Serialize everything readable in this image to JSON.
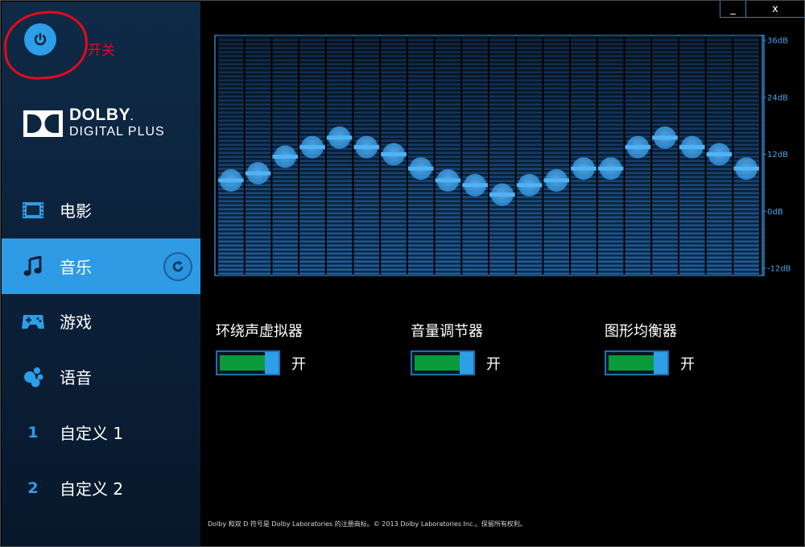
{
  "power": {
    "annotation": "开关",
    "icon": "power-icon"
  },
  "logo": {
    "name": "DOLBY",
    "sub": "DIGITAL PLUS",
    "trademark": "."
  },
  "nav": [
    {
      "label": "电影",
      "icon": "film-icon"
    },
    {
      "label": "音乐",
      "icon": "music-note-icon",
      "active": true,
      "reset_icon": "reset-icon"
    },
    {
      "label": "游戏",
      "icon": "gamepad-icon"
    },
    {
      "label": "语音",
      "icon": "voice-icon"
    },
    {
      "label": "自定义 1",
      "badge": "1"
    },
    {
      "label": "自定义 2",
      "badge": "2"
    }
  ],
  "window": {
    "minimize": "_",
    "close": "x"
  },
  "equalizer": {
    "db_labels": [
      "36dB",
      "24dB",
      "12dB",
      "0dB",
      "-12dB"
    ],
    "db_values": [
      36,
      24,
      12,
      0,
      -12
    ],
    "range": [
      -12,
      36
    ],
    "bands": [
      6.5,
      8,
      11.5,
      13.5,
      15.5,
      13.5,
      12,
      9,
      6.5,
      5.5,
      3.5,
      5.5,
      6.5,
      9,
      9,
      13.5,
      15.5,
      13.5,
      12,
      9
    ]
  },
  "toggles": [
    {
      "label": "环绕声虚拟器",
      "state": "开",
      "on": true
    },
    {
      "label": "音量调节器",
      "state": "开",
      "on": true
    },
    {
      "label": "图形均衡器",
      "state": "开",
      "on": true
    }
  ],
  "footer": "Dolby 和双 D 符号是 Dolby Laboratories 的注册商标。© 2013 Dolby Laboratories Inc.。保留所有权利。",
  "colors": {
    "accent": "#2d9ee8",
    "sidebar": "#0f2a47",
    "toggle_on": "#0a9a3c",
    "annotation": "#e5091b"
  }
}
